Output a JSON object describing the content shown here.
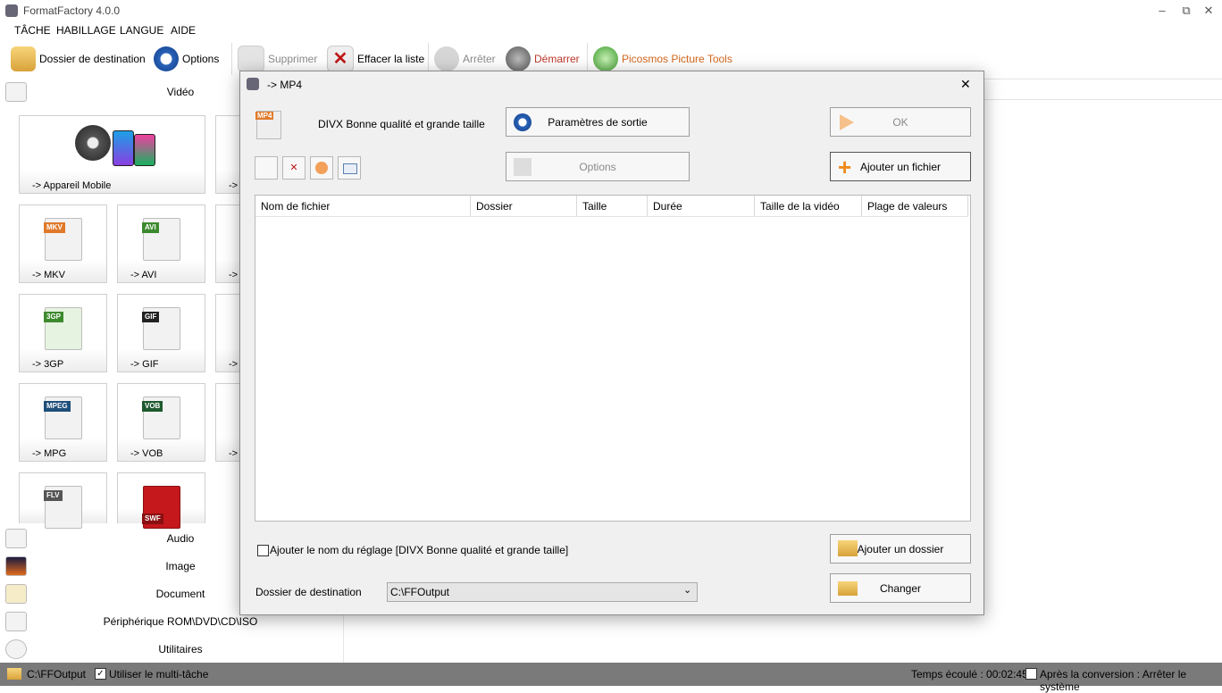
{
  "window": {
    "title": "FormatFactory 4.0.0",
    "min": "–",
    "restore": "⧉",
    "close": "✕"
  },
  "menu": [
    "TÂCHE",
    "HABILLAGE",
    "LANGUE",
    "AIDE"
  ],
  "toolbar": {
    "dest": "Dossier de destination",
    "options": "Options",
    "delete": "Supprimer",
    "clear": "Effacer la liste",
    "stop": "Arrêter",
    "start": "Démarrer",
    "picosmos": "Picosmos Picture Tools"
  },
  "sidebar": {
    "video": "Vidéo",
    "tiles": {
      "mobile": "-> Appareil Mobile",
      "mkv": "-> MKV",
      "avi": "-> AVI",
      "3gp": "-> 3GP",
      "gif": "-> GIF",
      "mpg": "-> MPG",
      "vob": "-> VOB",
      "partial": "->"
    },
    "badges": {
      "mkv": "MKV",
      "avi": "AVI",
      "gp3": "3GP",
      "gif": "GIF",
      "mpeg": "MPEG",
      "vob": "VOB",
      "flv": "FLV",
      "swf": "SWF"
    },
    "categories": [
      "Audio",
      "Image",
      "Document",
      "Périphérique ROM\\DVD\\CD\\ISO",
      "Utilitaires"
    ]
  },
  "dialog": {
    "title": "-> MP4",
    "badge": "MP4",
    "preset": "DIVX Bonne qualité et grande taille",
    "output_settings": "Paramètres de sortie",
    "ok": "OK",
    "options": "Options",
    "add_file": "Ajouter un fichier",
    "columns": [
      "Nom de fichier",
      "Dossier",
      "Taille",
      "Durée",
      "Taille de la vidéo",
      "Plage de valeurs"
    ],
    "add_preset_name": "Ajouter le nom du réglage [DIVX Bonne qualité et grande taille]",
    "add_folder": "Ajouter un dossier",
    "dest_label": "Dossier de destination",
    "dest_value": "C:\\FFOutput",
    "change": "Changer",
    "close": "✕"
  },
  "status": {
    "path": "C:\\FFOutput",
    "multitask": "Utiliser le multi-tâche",
    "elapsed": "Temps écoulé : 00:02:45",
    "after": "Après la conversion : Arrêter le système"
  }
}
